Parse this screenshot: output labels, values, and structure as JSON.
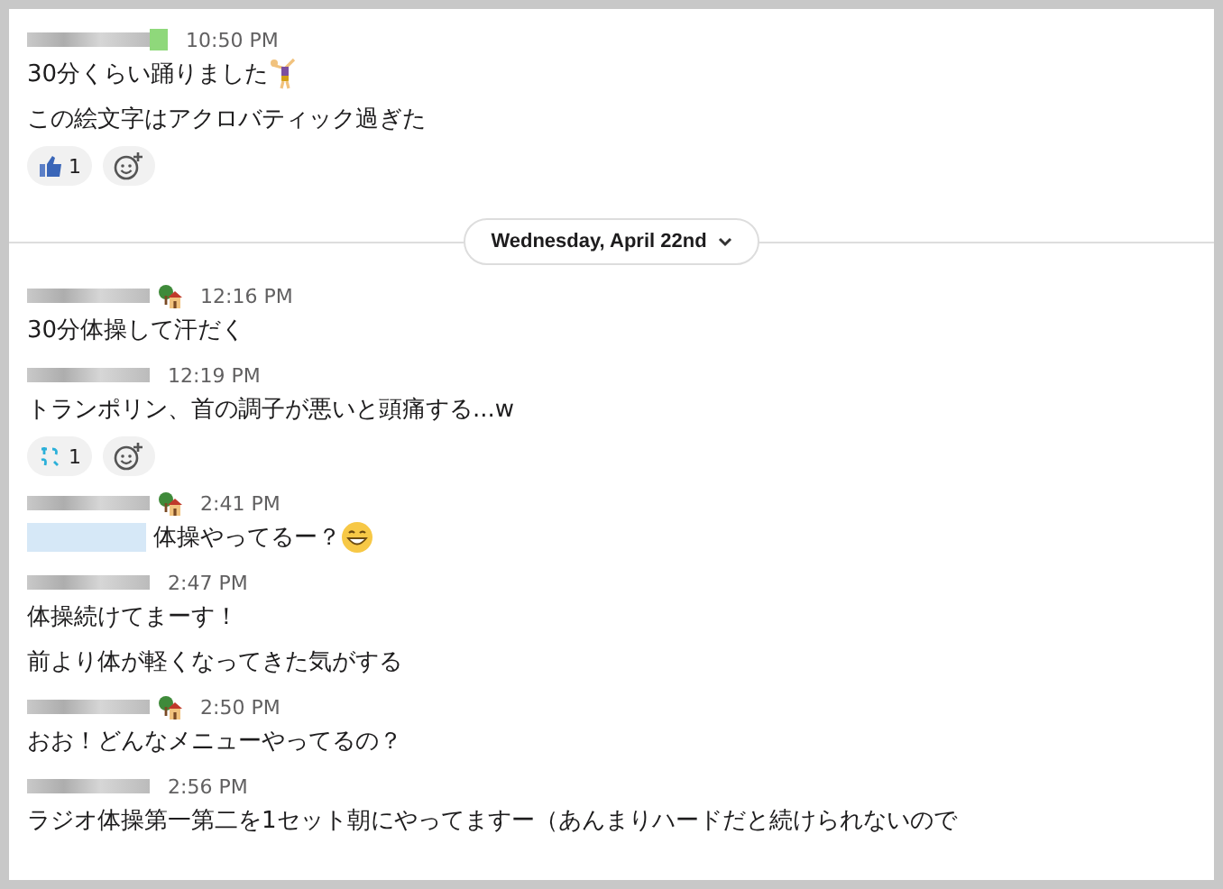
{
  "messages_before": [
    {
      "time": "10:50 PM",
      "name_tag": {
        "color": "#8fd87b"
      },
      "lines": [
        {
          "kind": "gymnast",
          "text": "30分くらい踊りました"
        },
        {
          "kind": "plain",
          "text": "この絵文字はアクロバティック過ぎた"
        }
      ],
      "reactions": [
        {
          "kind": "thumbs",
          "count": "1"
        }
      ]
    }
  ],
  "date_divider": {
    "label": "Wednesday, April 22nd"
  },
  "messages": [
    {
      "time": "12:16 PM",
      "status_emoji": true,
      "lines": [
        {
          "kind": "plain",
          "text": "30分体操して汗だく"
        }
      ]
    },
    {
      "time": "12:19 PM",
      "lines": [
        {
          "kind": "plain",
          "text": "トランポリン、首の調子が悪いと頭痛する...w"
        }
      ],
      "reactions": [
        {
          "kind": "wakaru",
          "count": "1"
        }
      ]
    },
    {
      "time": "2:41 PM",
      "status_emoji": true,
      "mention": true,
      "lines": [
        {
          "kind": "grin",
          "text": "体操やってるー？"
        }
      ]
    },
    {
      "time": "2:47 PM",
      "lines": [
        {
          "kind": "plain",
          "text": "体操続けてまーす！"
        },
        {
          "kind": "plain",
          "text": "前より体が軽くなってきた気がする"
        }
      ]
    },
    {
      "time": "2:50 PM",
      "status_emoji": true,
      "lines": [
        {
          "kind": "plain",
          "text": "おお！どんなメニューやってるの？"
        }
      ]
    },
    {
      "time": "2:56 PM",
      "lines": [
        {
          "kind": "plain",
          "text": "ラジオ体操第一第二を1セット朝にやってますー（あんまりハードだと続けられないので"
        }
      ]
    }
  ]
}
